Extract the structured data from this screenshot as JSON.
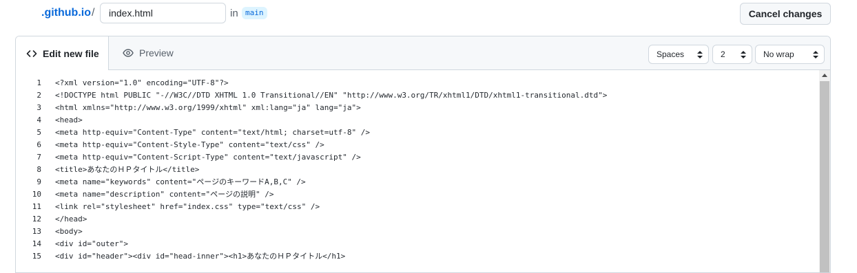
{
  "header": {
    "repo": ".github.io",
    "separator": "/",
    "filename": "index.html",
    "in_label": "in",
    "branch": "main",
    "cancel_label": "Cancel changes"
  },
  "tabs": {
    "edit_label": "Edit new file",
    "preview_label": "Preview"
  },
  "toolbar": {
    "indent_mode": "Spaces",
    "indent_size": "2",
    "wrap_mode": "No wrap"
  },
  "code": {
    "lines": [
      {
        "n": "1",
        "text": "<?xml version=\"1.0\" encoding=\"UTF-8\"?>"
      },
      {
        "n": "2",
        "text": "<!DOCTYPE html PUBLIC \"-//W3C//DTD XHTML 1.0 Transitional//EN\" \"http://www.w3.org/TR/xhtml1/DTD/xhtml1-transitional.dtd\">"
      },
      {
        "n": "3",
        "text": "<html xmlns=\"http://www.w3.org/1999/xhtml\" xml:lang=\"ja\" lang=\"ja\">"
      },
      {
        "n": "4",
        "text": "<head>"
      },
      {
        "n": "5",
        "text": "<meta http-equiv=\"Content-Type\" content=\"text/html; charset=utf-8\" />"
      },
      {
        "n": "6",
        "text": "<meta http-equiv=\"Content-Style-Type\" content=\"text/css\" />"
      },
      {
        "n": "7",
        "text": "<meta http-equiv=\"Content-Script-Type\" content=\"text/javascript\" />"
      },
      {
        "n": "8",
        "text": "<title>あなたのＨＰタイトル</title>"
      },
      {
        "n": "9",
        "text": "<meta name=\"keywords\" content=\"ページのキーワードA,B,C\" />"
      },
      {
        "n": "10",
        "text": "<meta name=\"description\" content=\"ページの説明\" />"
      },
      {
        "n": "11",
        "text": "<link rel=\"stylesheet\" href=\"index.css\" type=\"text/css\" />"
      },
      {
        "n": "12",
        "text": "</head>"
      },
      {
        "n": "13",
        "text": "<body>"
      },
      {
        "n": "14",
        "text": "<div id=\"outer\">"
      },
      {
        "n": "15",
        "text": "<div id=\"header\"><div id=\"head-inner\"><h1>あなたのＨＰタイトル</h1>"
      }
    ]
  },
  "colors": {
    "link": "#0969da",
    "branch_bg": "#ddf4ff",
    "border": "#d0d7de",
    "tabbar_bg": "#f6f8fa"
  },
  "icons": {
    "edit_tab": "code-icon",
    "preview_tab": "eye-icon",
    "select": "select-arrows-icon",
    "scroll_up": "triangle-up-icon"
  }
}
